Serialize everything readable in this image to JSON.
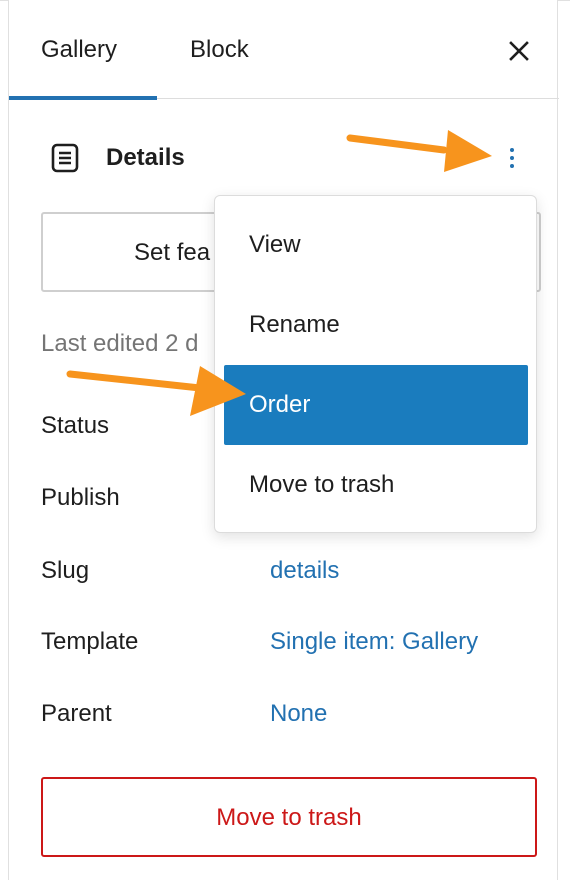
{
  "tabs": {
    "gallery": "Gallery",
    "block": "Block",
    "close_icon": "close-icon"
  },
  "details": {
    "title": "Details",
    "icon": "document-icon",
    "more_icon": "more-vertical-icon"
  },
  "featured_button": "Set fea",
  "last_edited": "Last edited 2 d",
  "meta": {
    "status_label": "Status",
    "publish_label": "Publish",
    "slug_label": "Slug",
    "slug_value": "details",
    "template_label": "Template",
    "template_value": "Single item: Gallery",
    "parent_label": "Parent",
    "parent_value": "None"
  },
  "trash_button": "Move to trash",
  "menu": {
    "items": [
      "View",
      "Rename",
      "Order",
      "Move to trash"
    ],
    "active_item": "Order"
  },
  "colors": {
    "accent": "#2271b1",
    "menu_active": "#1a7cbe",
    "danger": "#cc1818",
    "annotation_arrow": "#f7941d"
  }
}
